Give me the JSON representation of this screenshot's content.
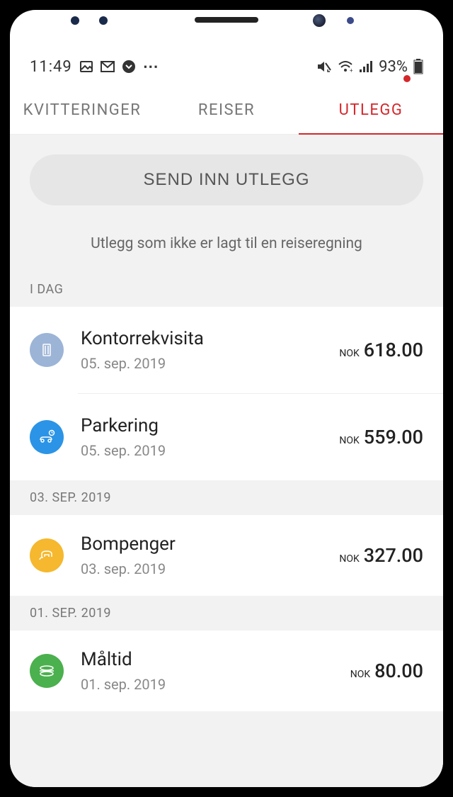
{
  "status_bar": {
    "time": "11:49",
    "battery": "93%"
  },
  "tabs": {
    "receipts": "KVITTERINGER",
    "travels": "REISER",
    "expenses": "UTLEGG"
  },
  "submit_button": "SEND INN UTLEGG",
  "info_text": "Utlegg som ikke er lagt til en reiseregning",
  "sections": [
    {
      "header": "I DAG",
      "items": [
        {
          "title": "Kontorrekvisita",
          "date": "05. sep. 2019",
          "currency": "NOK",
          "amount": "618.00",
          "icon": "office"
        },
        {
          "title": "Parkering",
          "date": "05. sep. 2019",
          "currency": "NOK",
          "amount": "559.00",
          "icon": "parking"
        }
      ]
    },
    {
      "header": "03. SEP. 2019",
      "items": [
        {
          "title": "Bompenger",
          "date": "03. sep. 2019",
          "currency": "NOK",
          "amount": "327.00",
          "icon": "toll"
        }
      ]
    },
    {
      "header": "01. SEP. 2019",
      "items": [
        {
          "title": "Måltid",
          "date": "01. sep. 2019",
          "currency": "NOK",
          "amount": "80.00",
          "icon": "meal"
        }
      ]
    }
  ]
}
